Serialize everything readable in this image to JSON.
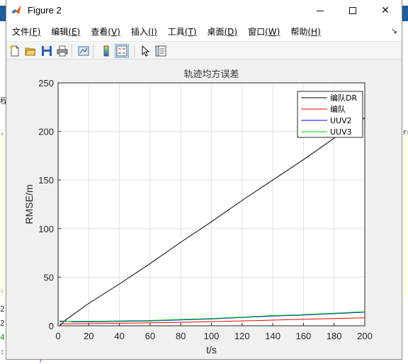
{
  "window": {
    "title": "Figure 2",
    "controls": {
      "minimize": "—",
      "maximize": "☐",
      "close": "✕"
    }
  },
  "menu": [
    {
      "label": "文件",
      "accel": "(F)"
    },
    {
      "label": "编辑",
      "accel": "(E)"
    },
    {
      "label": "查看",
      "accel": "(V)"
    },
    {
      "label": "插入",
      "accel": "(I)"
    },
    {
      "label": "工具",
      "accel": "(T)"
    },
    {
      "label": "桌面",
      "accel": "(D)"
    },
    {
      "label": "窗口",
      "accel": "(W)"
    },
    {
      "label": "帮助",
      "accel": "(H)"
    }
  ],
  "toolbar_icons": [
    "new-figure-icon",
    "open-file-icon",
    "save-icon",
    "print-icon",
    "link-plot-icon",
    "colorbar-icon",
    "legend-icon",
    "pointer-icon",
    "property-inspector-icon"
  ],
  "background_fragments": {
    "left": [
      "程",
      ".r",
      "'",
      "2",
      "2",
      "4",
      ":"
    ],
    "right": [
      "ro"
    ],
    "bottom": "'  '  ')"
  },
  "chart_data": {
    "type": "line",
    "title": "轨迹均方误差",
    "xlabel": "t/s",
    "ylabel": "RMSE/m",
    "xlim": [
      0,
      200
    ],
    "ylim": [
      0,
      250
    ],
    "xticks": [
      0,
      20,
      40,
      60,
      80,
      100,
      120,
      140,
      160,
      180,
      200
    ],
    "yticks": [
      0,
      50,
      100,
      150,
      200,
      250
    ],
    "grid": true,
    "legend_position": "top-right",
    "series": [
      {
        "name": "编队DR",
        "color": "#000000",
        "x": [
          1,
          5,
          20,
          40,
          60,
          80,
          100,
          120,
          140,
          160,
          180,
          200
        ],
        "y": [
          0,
          6,
          23,
          43,
          64,
          86,
          107,
          129,
          150,
          171,
          193,
          214
        ]
      },
      {
        "name": "编队",
        "color": "#ff0000",
        "x": [
          1,
          20,
          40,
          60,
          80,
          100,
          120,
          140,
          160,
          180,
          200
        ],
        "y": [
          2,
          2.2,
          2.6,
          3,
          3.6,
          4.2,
          5,
          5.8,
          6.6,
          7.4,
          8.2
        ]
      },
      {
        "name": "UUV2",
        "color": "#0000ff",
        "x": [
          1,
          10,
          20,
          40,
          60,
          80,
          100,
          120,
          140,
          160,
          180,
          200
        ],
        "y": [
          5,
          4,
          4,
          4.5,
          5,
          6,
          7,
          8.5,
          10,
          11,
          12.5,
          14
        ]
      },
      {
        "name": "UUV3",
        "color": "#00cc00",
        "x": [
          1,
          10,
          20,
          40,
          60,
          80,
          100,
          120,
          140,
          160,
          180,
          200
        ],
        "y": [
          4,
          4.5,
          4.5,
          5,
          5.5,
          6.5,
          7.5,
          9,
          10.5,
          11.5,
          13,
          14.5
        ]
      }
    ]
  }
}
